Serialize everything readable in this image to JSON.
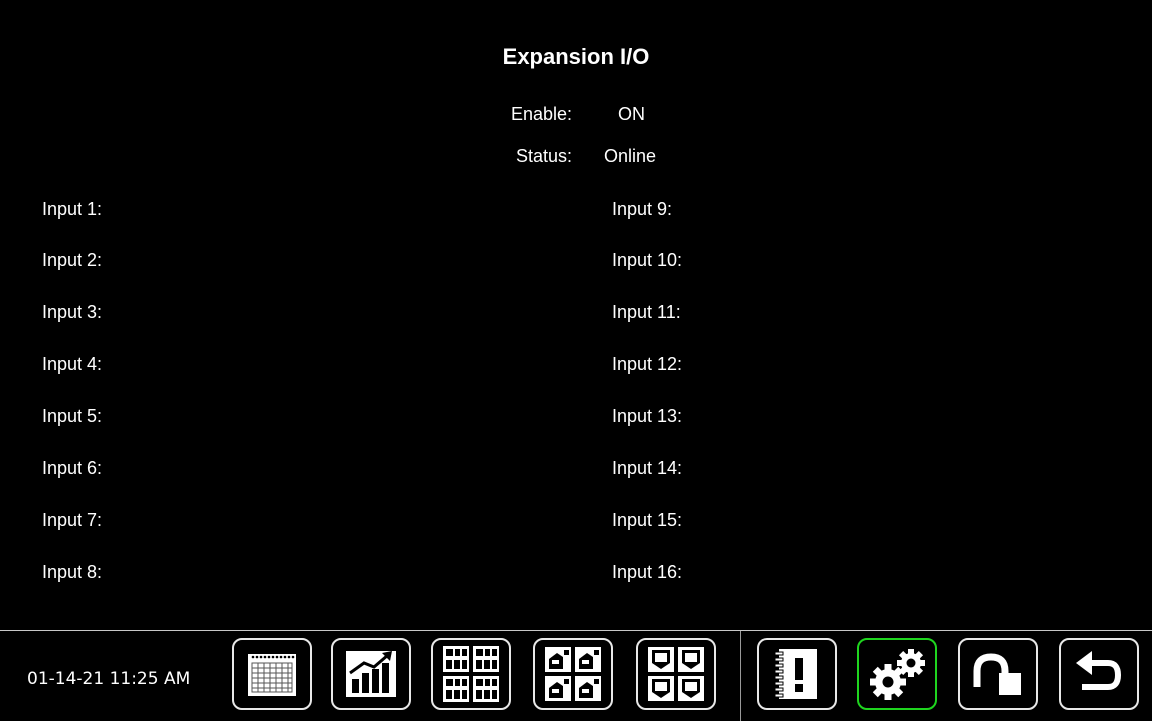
{
  "screen": {
    "title": "Expansion I/O"
  },
  "status": {
    "enable_label": "Enable:",
    "enable_value": "ON",
    "status_label": "Status:",
    "status_value": "Online"
  },
  "inputs_left": [
    "Input 1:",
    "Input 2:",
    "Input 3:",
    "Input 4:",
    "Input 5:",
    "Input 6:",
    "Input 7:",
    "Input 8:"
  ],
  "inputs_right": [
    "Input 9:",
    "Input 10:",
    "Input 11:",
    "Input 12:",
    "Input 13:",
    "Input 14:",
    "Input 15:",
    "Input 16:"
  ],
  "footer": {
    "datetime": "01-14-21 11:25 AM",
    "buttons": [
      {
        "name": "calendar-button",
        "icon": "calendar-icon"
      },
      {
        "name": "trend-chart-button",
        "icon": "bar-chart-trend-icon"
      },
      {
        "name": "product-overview-button",
        "icon": "product-grid-icon"
      },
      {
        "name": "bins-overview-button",
        "icon": "bins-grid-icon"
      },
      {
        "name": "tanks-overview-button",
        "icon": "tanks-grid-icon"
      },
      {
        "name": "alarm-log-button",
        "icon": "alarm-notebook-icon"
      },
      {
        "name": "settings-button",
        "icon": "gears-icon",
        "active": true
      },
      {
        "name": "unlock-button",
        "icon": "unlock-icon"
      },
      {
        "name": "back-button",
        "icon": "back-arrow-icon"
      }
    ]
  },
  "colors": {
    "background": "#000000",
    "text": "#ffffff",
    "active_border": "#1fd51f",
    "button_border": "#e8e8e8"
  }
}
